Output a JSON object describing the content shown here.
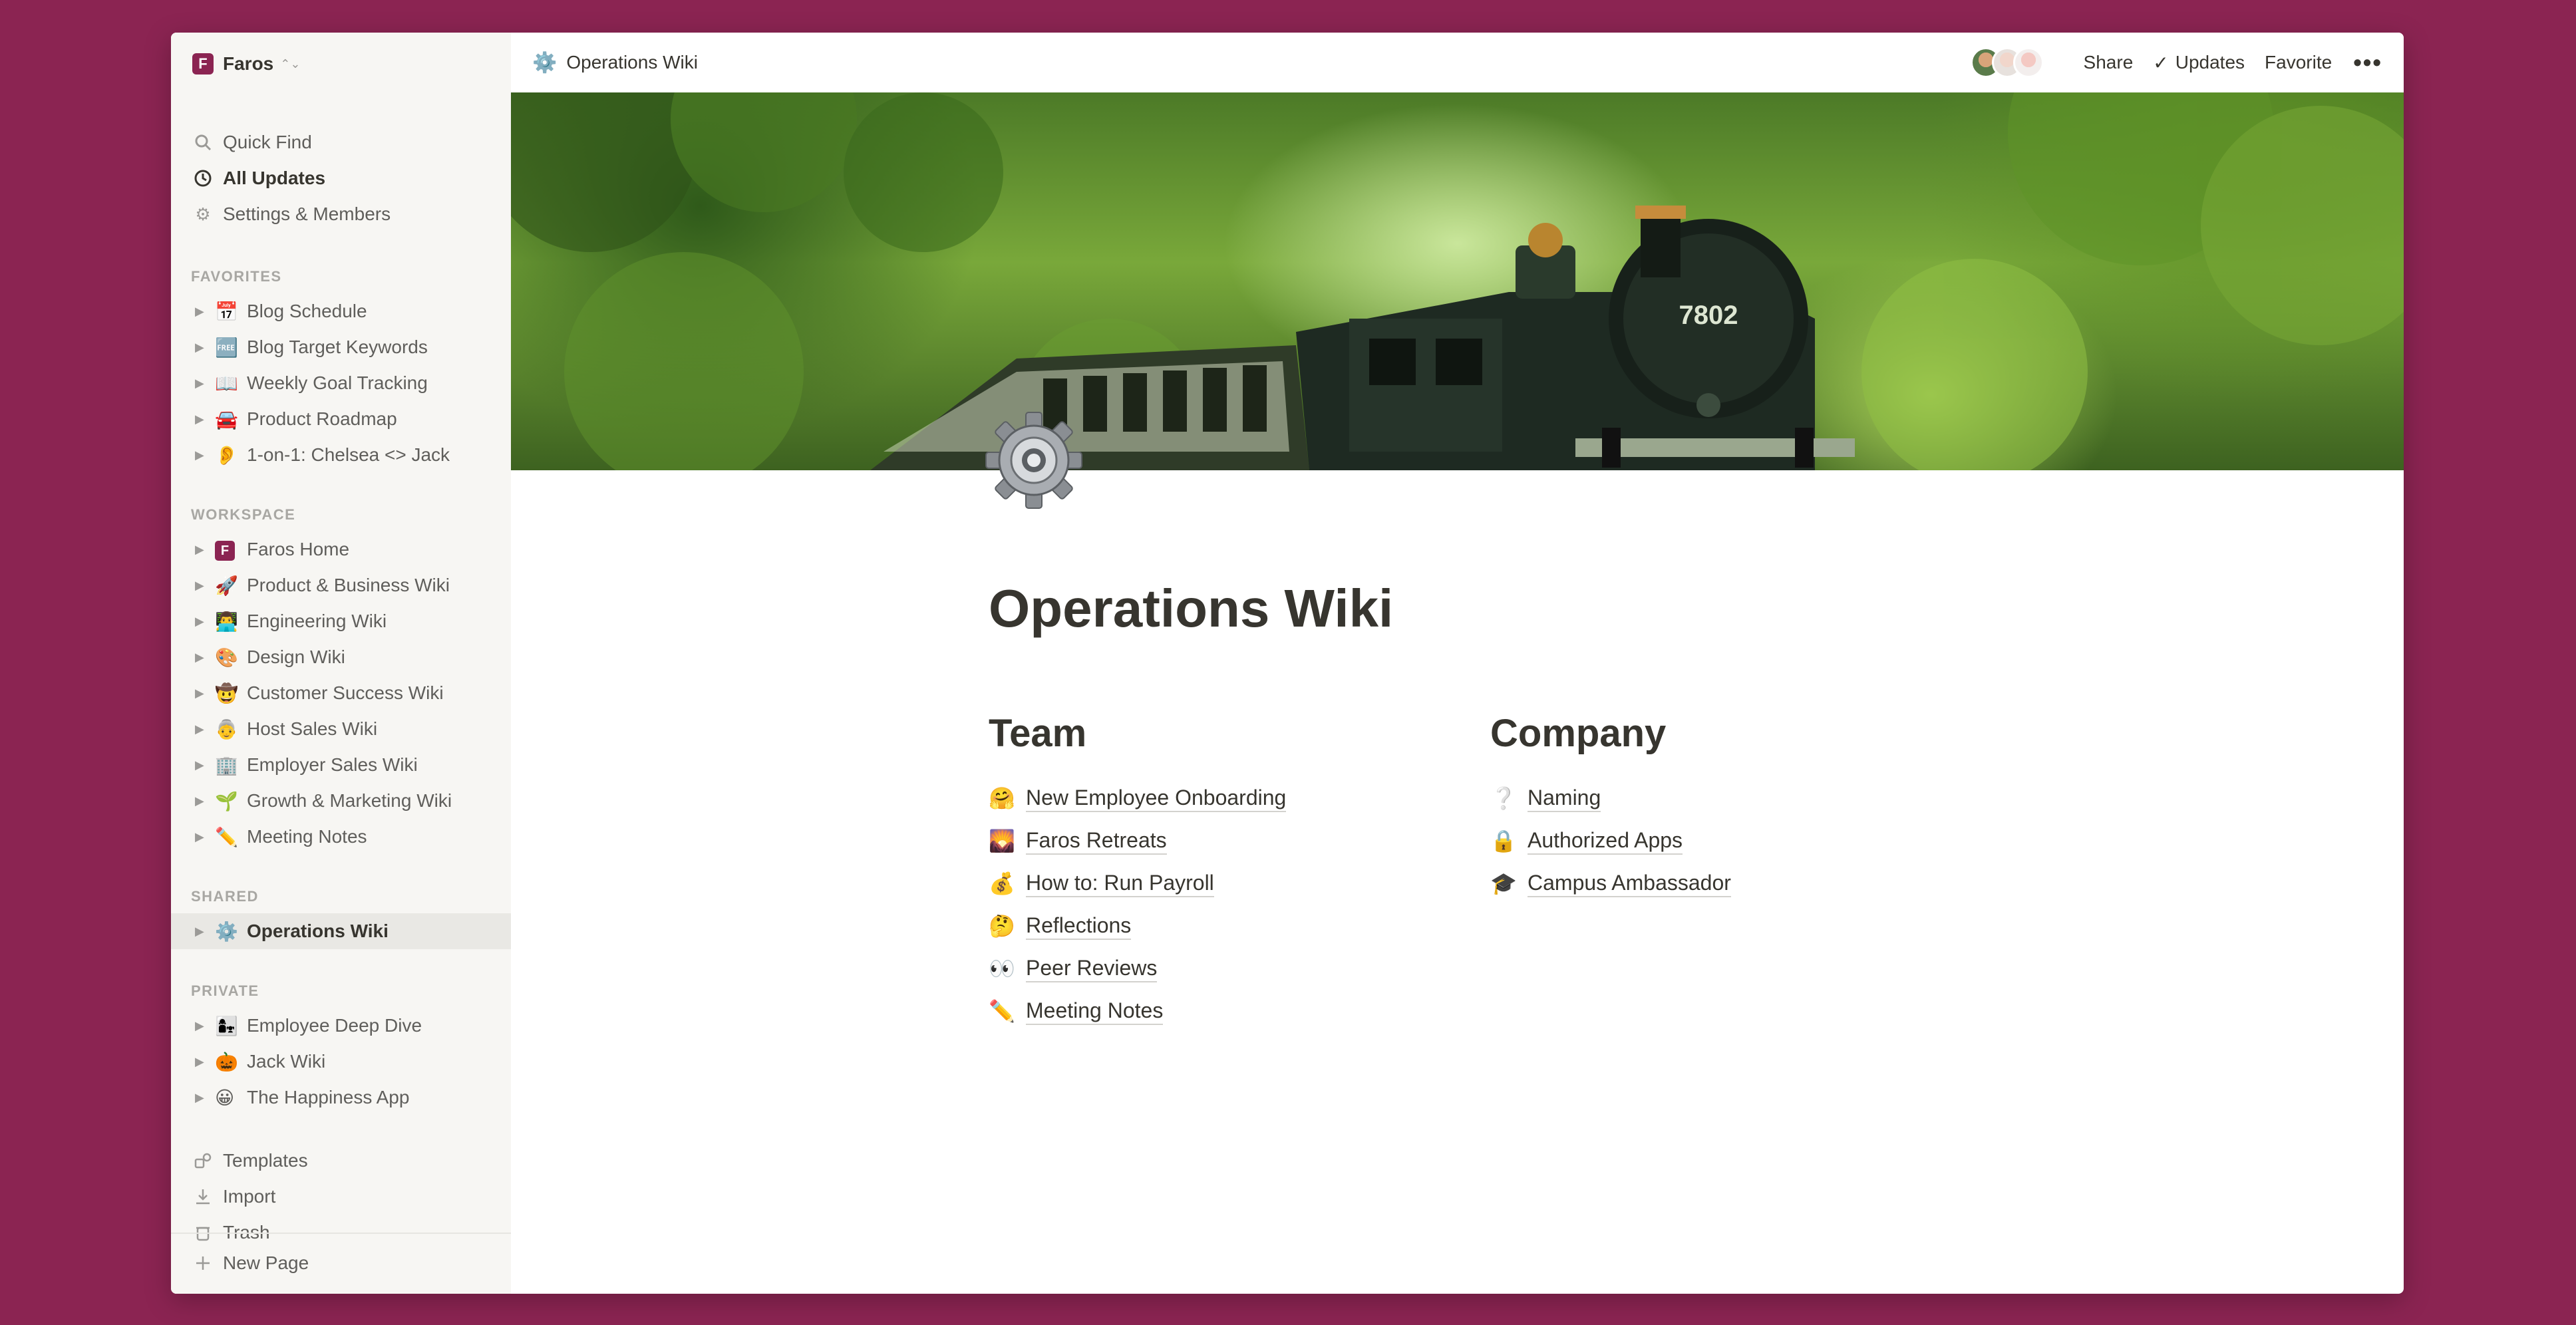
{
  "workspace": {
    "name": "Faros",
    "logo_letter": "F"
  },
  "sidebar": {
    "top_items": [
      {
        "label": "Quick Find",
        "icon": "search-icon"
      },
      {
        "label": "All Updates",
        "icon": "clock-icon"
      },
      {
        "label": "Settings & Members",
        "icon": "gear-icon"
      }
    ],
    "sections": {
      "favorites": "FAVORITES",
      "workspace": "WORKSPACE",
      "shared": "SHARED",
      "private": "PRIVATE"
    },
    "favorites": [
      {
        "emoji": "📅",
        "label": "Blog Schedule"
      },
      {
        "emoji": "🆓",
        "label": "Blog Target Keywords"
      },
      {
        "emoji": "📖",
        "label": "Weekly Goal Tracking"
      },
      {
        "emoji": "🚘",
        "label": "Product Roadmap"
      },
      {
        "emoji": "👂",
        "label": "1-on-1: Chelsea <> Jack"
      }
    ],
    "workspace_pages": [
      {
        "emoji": "F",
        "label": "Faros Home"
      },
      {
        "emoji": "🚀",
        "label": "Product & Business Wiki"
      },
      {
        "emoji": "👨‍💻",
        "label": "Engineering Wiki"
      },
      {
        "emoji": "🎨",
        "label": "Design Wiki"
      },
      {
        "emoji": "🤠",
        "label": "Customer Success Wiki"
      },
      {
        "emoji": "👵",
        "label": "Host Sales Wiki"
      },
      {
        "emoji": "🏢",
        "label": "Employer Sales Wiki"
      },
      {
        "emoji": "🌱",
        "label": "Growth & Marketing Wiki"
      },
      {
        "emoji": "✏️",
        "label": "Meeting Notes"
      }
    ],
    "shared_pages": [
      {
        "emoji": "⚙️",
        "label": "Operations Wiki"
      }
    ],
    "private_pages": [
      {
        "emoji": "👩‍👧",
        "label": "Employee Deep Dive"
      },
      {
        "emoji": "🎃",
        "label": "Jack Wiki"
      },
      {
        "emoji": "😀",
        "label": "The Happiness App"
      }
    ],
    "bottom_items": [
      {
        "label": "Templates",
        "icon": "templates-icon"
      },
      {
        "label": "Import",
        "icon": "download-icon"
      },
      {
        "label": "Trash",
        "icon": "trash-icon"
      }
    ],
    "new_page": "New Page"
  },
  "topbar": {
    "breadcrumb_emoji": "⚙️",
    "breadcrumb": "Operations Wiki",
    "share": "Share",
    "updates": "Updates",
    "favorite": "Favorite",
    "more": "•••"
  },
  "page": {
    "title": "Operations Wiki",
    "cover_train_number": "7802",
    "columns": [
      {
        "heading": "Team",
        "links": [
          {
            "emoji": "🤗",
            "label": "New Employee Onboarding"
          },
          {
            "emoji": "🌄",
            "label": "Faros Retreats"
          },
          {
            "emoji": "💰",
            "label": "How to: Run Payroll"
          },
          {
            "emoji": "🤔",
            "label": "Reflections"
          },
          {
            "emoji": "👀",
            "label": "Peer Reviews"
          },
          {
            "emoji": "✏️",
            "label": "Meeting Notes"
          }
        ]
      },
      {
        "heading": "Company",
        "links": [
          {
            "emoji": "❔",
            "label": "Naming"
          },
          {
            "emoji": "🔒",
            "label": "Authorized Apps"
          },
          {
            "emoji": "🎓",
            "label": "Campus Ambassador"
          }
        ]
      }
    ]
  }
}
